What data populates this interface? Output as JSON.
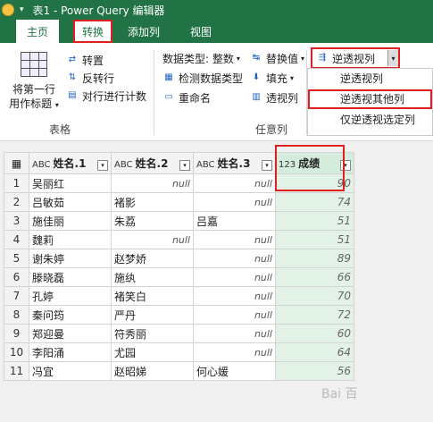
{
  "window": {
    "title": "表1 - Power Query 编辑器"
  },
  "tabs": [
    "主页",
    "转换",
    "添加列",
    "视图"
  ],
  "ribbon": {
    "first_row_header": [
      "将第一行",
      "用作标题"
    ],
    "transpose": "转置",
    "reverse_rows": "反转行",
    "count_rows": "对行进行计数",
    "table_group": "表格",
    "data_type": "数据类型: 整数",
    "replace_values": "替换值",
    "unpivot": "逆透视列",
    "detect_type": "检测数据类型",
    "fill": "填充",
    "rename": "重命名",
    "pivot": "透视列",
    "any_column_group": "任意列",
    "unpivot_menu": [
      "逆透视列",
      "逆透视其他列",
      "仅逆透视选定列"
    ]
  },
  "table": {
    "columns": [
      {
        "type": "ABC",
        "name": "姓名.1"
      },
      {
        "type": "ABC",
        "name": "姓名.2"
      },
      {
        "type": "ABC",
        "name": "姓名.3"
      },
      {
        "type": "123",
        "name": "成绩"
      }
    ],
    "rows": [
      [
        "1",
        "吴丽红",
        "null",
        "null",
        "90"
      ],
      [
        "2",
        "吕敏茹",
        "褚影",
        "null",
        "74"
      ],
      [
        "3",
        "施佳丽",
        "朱荔",
        "吕嘉",
        "51"
      ],
      [
        "4",
        "魏莉",
        "null",
        "null",
        "51"
      ],
      [
        "5",
        "谢朱婷",
        "赵梦娇",
        "null",
        "89"
      ],
      [
        "6",
        "滕晓磊",
        "施纨",
        "null",
        "66"
      ],
      [
        "7",
        "孔婷",
        "褚笑白",
        "null",
        "70"
      ],
      [
        "8",
        "秦问筠",
        "严丹",
        "null",
        "72"
      ],
      [
        "9",
        "郑迎曼",
        "符秀丽",
        "null",
        "60"
      ],
      [
        "10",
        "李阳涌",
        "尤园",
        "null",
        "64"
      ],
      [
        "11",
        "冯宜",
        "赵昭娣",
        "何心媛",
        "56"
      ]
    ]
  },
  "watermark": "Bai 百"
}
